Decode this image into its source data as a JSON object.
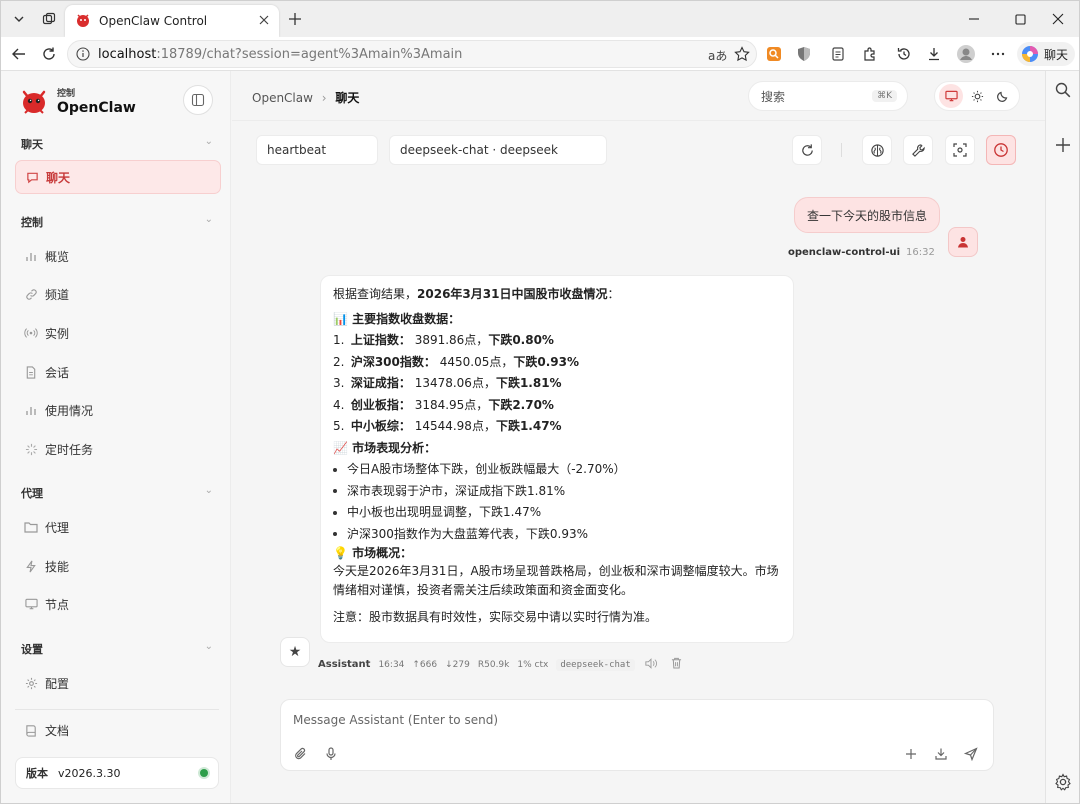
{
  "browser": {
    "tab_title": "OpenClaw Control",
    "url_host": "localhost",
    "url_rest": ":18789/chat?session=agent%3Amain%3Amain",
    "copilot_label": "聊天"
  },
  "sidebar": {
    "logo_sub": "控制",
    "logo_main": "OpenClaw",
    "sections": {
      "chat": "聊天",
      "control": "控制",
      "agent": "代理",
      "settings": "设置"
    },
    "items": {
      "chat": "聊天",
      "overview": "概览",
      "channels": "频道",
      "instances": "实例",
      "sessions": "会话",
      "usage": "使用情况",
      "cron": "定时任务",
      "agents": "代理",
      "skills": "技能",
      "nodes": "节点",
      "config": "配置",
      "docs": "文档"
    },
    "version_label": "版本",
    "version_value": "v2026.3.30",
    "status_color": "#2d9e4a"
  },
  "header": {
    "crumb_root": "OpenClaw",
    "crumb_sep": "›",
    "crumb_current": "聊天",
    "search_placeholder": "搜索",
    "search_kbd": "⌘K"
  },
  "session": {
    "session_pill": "heartbeat",
    "model_pill": "deepseek-chat · deepseek"
  },
  "user_message": {
    "text": "查一下今天的股市信息",
    "sender": "openclaw-control-ui",
    "time": "16:32"
  },
  "assistant_message": {
    "intro_prefix": "根据查询结果，",
    "intro_bold": "2026年3月31日中国股市收盘情况",
    "intro_suffix": "：",
    "section1": "📊 主要指数收盘数据：",
    "indices": [
      {
        "n": "1.",
        "name": "上证指数",
        "sep": "：",
        "points": "3891.86点，",
        "change": "下跌0.80%"
      },
      {
        "n": "2.",
        "name": "沪深300指数",
        "sep": "：",
        "points": "4450.05点，",
        "change": "下跌0.93%"
      },
      {
        "n": "3.",
        "name": "深证成指",
        "sep": "：",
        "points": "13478.06点，",
        "change": "下跌1.81%"
      },
      {
        "n": "4.",
        "name": "创业板指",
        "sep": "：",
        "points": "3184.95点，",
        "change": "下跌2.70%"
      },
      {
        "n": "5.",
        "name": "中小板综",
        "sep": "：",
        "points": "14544.98点，",
        "change": "下跌1.47%"
      }
    ],
    "section2": "📈 市场表现分析：",
    "bullets": [
      "今日A股市场整体下跌，创业板跌幅最大（-2.70%）",
      "深市表现弱于沪市，深证成指下跌1.81%",
      "中小板也出现明显调整，下跌1.47%",
      "沪深300指数作为大盘蓝筹代表，下跌0.93%"
    ],
    "section3": "💡 市场概况：",
    "summary_line1": "今天是2026年3月31日，A股市场呈现普跌格局，创业板和深市调整幅度较大。市场",
    "summary_line2": "情绪相对谨慎，投资者需关注后续政策面和资金面变化。",
    "note": "注意：股市数据具有时效性，实际交易中请以实时行情为准。",
    "meta": {
      "sender": "Assistant",
      "time": "16:34",
      "tokens_in": "↑666",
      "tokens_out": "↓279",
      "cache": "R50.9k",
      "ctx": "1% ctx",
      "model": "deepseek-chat"
    }
  },
  "composer": {
    "placeholder": "Message Assistant (Enter to send)"
  }
}
